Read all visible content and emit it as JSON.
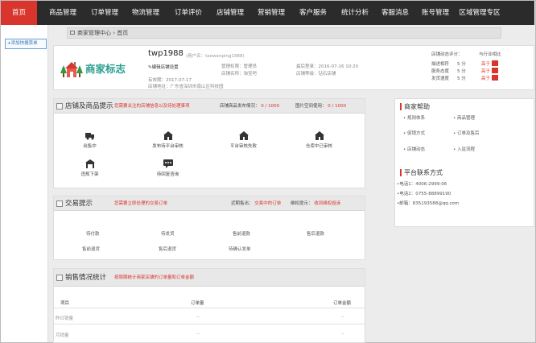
{
  "nav": {
    "items": [
      "首页",
      "商品管理",
      "订单管理",
      "物流管理",
      "订单评价",
      "店铺管理",
      "营销管理",
      "客户服务",
      "统计分析",
      "客服消息",
      "账号管理",
      "区域管理专区"
    ]
  },
  "sidebar": {
    "add_menu": "添加快捷菜单"
  },
  "breadcrumb": {
    "text": "商家管理中心 › 首页"
  },
  "store": {
    "logo_text": "商家标志",
    "name": "twp1988",
    "username": "(用户名：taowenping1988)",
    "edit_link": "编辑店铺设置",
    "role": "管理权限：管理员",
    "store_name": "店铺名称：淘宝吧",
    "last_login": "最后登录：2016-07-16 10:20",
    "store_level": "店铺等级：钻石店铺",
    "valid_until": "有效期：2017-07-17",
    "address": "店铺地址：广东省深圳市南山区科技园",
    "rating_title": "店铺动态评分：",
    "rating_compare": "与行业相比",
    "ratings": [
      {
        "label": "描述相符",
        "value": "5 分",
        "compare": "高于"
      },
      {
        "label": "服务态度",
        "value": "5 分",
        "compare": "高于"
      },
      {
        "label": "发货速度",
        "value": "5 分",
        "compare": "高于"
      }
    ]
  },
  "goods_panel": {
    "title": "店铺及商品提示",
    "hint": "您需要关注的店铺信息以及待处理事项",
    "publish_limit": "店铺商品发布情况：",
    "publish_value": "0 / 1000",
    "space_label": "图片空间使用：",
    "space_value": "0 / 1000",
    "items": [
      "出售中",
      "发布待平台审核",
      "平台审核失败",
      "仓库中已审核",
      "违规下架",
      "待回复咨询"
    ]
  },
  "trade_panel": {
    "title": "交易提示",
    "hint": "您需要立即处理的交易订单",
    "recent_label": "近期售出：",
    "recent_value": "交易中的订单",
    "rights_label": "维权提示：",
    "rights_value": "收到维权投诉",
    "row1": [
      "待付款",
      "待发货",
      "售前退款",
      "售后退款"
    ],
    "row2": [
      "售前退货",
      "售后退货",
      "待确认发单"
    ]
  },
  "sales_panel": {
    "title": "销售情况统计",
    "hint": "按周期统计商家店铺的订单量和订单金额",
    "col_item": "项目",
    "col_count": "订单量",
    "col_amount": "订单金额",
    "rows": [
      {
        "label": "昨日销量",
        "count": "--",
        "amount": "--"
      },
      {
        "label": "月销量",
        "count": "--",
        "amount": "--"
      }
    ]
  },
  "help": {
    "title": "商家帮助",
    "links": [
      "规则体系",
      "商品管理",
      "促销方式",
      "订单及售后",
      "店铺动态",
      "入驻流程"
    ],
    "contact_title": "平台联系方式",
    "phone1": "•电话1：4006-2999-06",
    "phone2": "•电话2：0755-88899190",
    "email": "•邮箱：835193588@qq.com"
  },
  "colors": {
    "nav_bg": "#2b2b2b",
    "accent": "#d9352c",
    "logo": "#2b9e8f"
  }
}
